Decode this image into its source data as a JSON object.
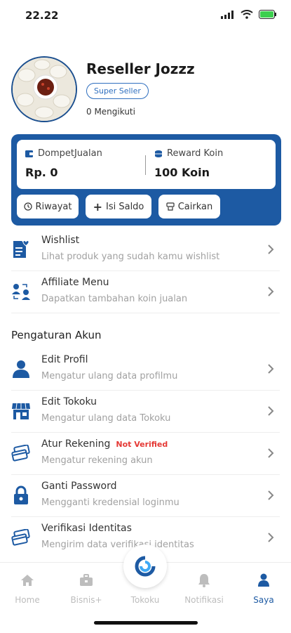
{
  "status_bar": {
    "time": "22.22"
  },
  "profile": {
    "name": "Reseller Jozzz",
    "badge": "Super Seller",
    "followers": "0 Mengikuti"
  },
  "wallet": {
    "dompet_label": "DompetJualan",
    "dompet_value": "Rp. 0",
    "reward_label": "Reward Koin",
    "reward_value": "100 Koin",
    "buttons": {
      "riwayat": "Riwayat",
      "isi_saldo": "Isi Saldo",
      "cairkan": "Cairkan"
    }
  },
  "menu": [
    {
      "title": "Wishlist",
      "subtitle": "Lihat produk yang sudah kamu wishlist",
      "icon": "wishlist-icon"
    },
    {
      "title": "Affiliate Menu",
      "subtitle": "Dapatkan tambahan koin jualan",
      "icon": "affiliate-icon"
    }
  ],
  "settings": {
    "title": "Pengaturan Akun",
    "items": [
      {
        "title": "Edit Profil",
        "subtitle": "Mengatur ulang data profilmu",
        "icon": "user-icon"
      },
      {
        "title": "Edit Tokoku",
        "subtitle": "Mengatur ulang data Tokoku",
        "icon": "store-icon"
      },
      {
        "title": "Atur Rekening",
        "tag": "Not Verified",
        "subtitle": "Mengatur rekening akun",
        "icon": "card-icon"
      },
      {
        "title": "Ganti Password",
        "subtitle": "Mengganti kredensial loginmu",
        "icon": "lock-icon"
      },
      {
        "title": "Verifikasi Identitas",
        "subtitle": "Mengirim data verifikasi identitas",
        "icon": "id-card-icon"
      }
    ]
  },
  "bottom_nav": {
    "home": "Home",
    "bisnis": "Bisnis+",
    "tokoku": "Tokoku",
    "notifikasi": "Notifikasi",
    "saya": "Saya"
  },
  "colors": {
    "primary": "#1d5aa3",
    "alert": "#e53935",
    "muted": "#a1a1a1"
  }
}
